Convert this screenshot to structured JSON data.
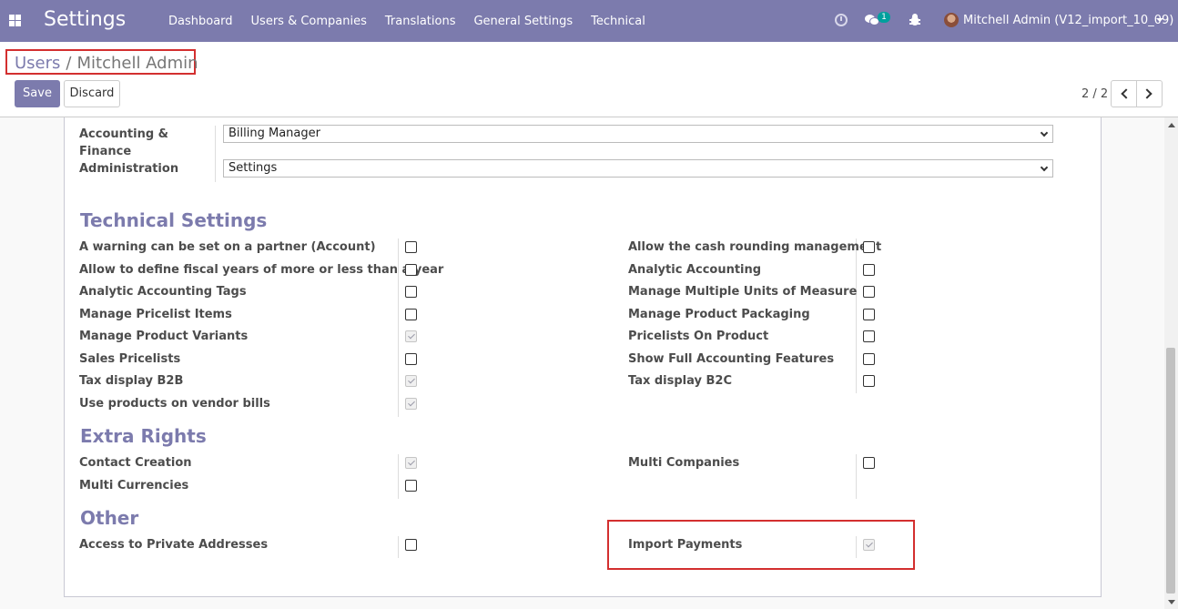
{
  "navbar": {
    "brand": "Settings",
    "menu": [
      "Dashboard",
      "Users & Companies",
      "Translations",
      "General Settings",
      "Technical"
    ],
    "chat_count": "1",
    "user": "Mitchell Admin (V12_import_10_09)"
  },
  "breadcrumb": {
    "parent": "Users",
    "separator": "/",
    "current": "Mitchell Admin"
  },
  "buttons": {
    "save": "Save",
    "discard": "Discard"
  },
  "pager": {
    "value": "2 / 2"
  },
  "accounting": {
    "label": "Accounting & Finance Administration",
    "select1": "Billing Manager",
    "select2": "Settings"
  },
  "technical": {
    "title": "Technical Settings",
    "left": [
      {
        "label": "A warning can be set on a partner (Account)",
        "checked": false
      },
      {
        "label": "Allow to define fiscal years of more or less than a year",
        "checked": false
      },
      {
        "label": "Analytic Accounting Tags",
        "checked": false
      },
      {
        "label": "Manage Pricelist Items",
        "checked": false
      },
      {
        "label": "Manage Product Variants",
        "checked": true
      },
      {
        "label": "Sales Pricelists",
        "checked": false
      },
      {
        "label": "Tax display B2B",
        "checked": true
      },
      {
        "label": "Use products on vendor bills",
        "checked": true
      }
    ],
    "right": [
      {
        "label": "Allow the cash rounding management",
        "checked": false
      },
      {
        "label": "Analytic Accounting",
        "checked": false
      },
      {
        "label": "Manage Multiple Units of Measure",
        "checked": false
      },
      {
        "label": "Manage Product Packaging",
        "checked": false
      },
      {
        "label": "Pricelists On Product",
        "checked": false
      },
      {
        "label": "Show Full Accounting Features",
        "checked": false
      },
      {
        "label": "Tax display B2C",
        "checked": false
      }
    ]
  },
  "extra": {
    "title": "Extra Rights",
    "left": [
      {
        "label": "Contact Creation",
        "checked": true
      },
      {
        "label": "Multi Currencies",
        "checked": false
      }
    ],
    "right": [
      {
        "label": "Multi Companies",
        "checked": false
      }
    ]
  },
  "other": {
    "title": "Other",
    "left": [
      {
        "label": "Access to Private Addresses",
        "checked": false
      }
    ],
    "right": [
      {
        "label": "Import Payments",
        "checked": true
      }
    ]
  },
  "colors": {
    "brand": "#7c7bad",
    "highlight": "#d32f2f"
  }
}
